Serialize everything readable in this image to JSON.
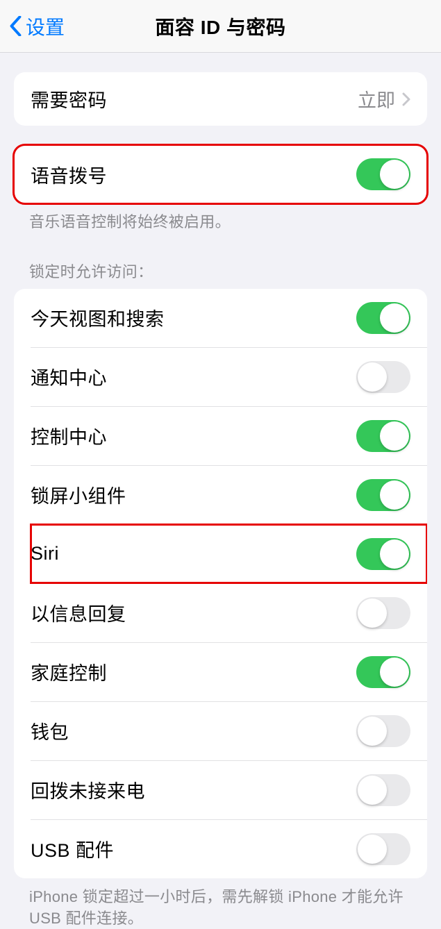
{
  "nav": {
    "back_label": "设置",
    "title": "面容 ID 与密码"
  },
  "require_passcode": {
    "label": "需要密码",
    "value": "立即"
  },
  "voice_dial": {
    "label": "语音拨号",
    "on": true,
    "footer": "音乐语音控制将始终被启用。"
  },
  "allow_access_header": "锁定时允许访问：",
  "allow_access": [
    {
      "label": "今天视图和搜索",
      "on": true
    },
    {
      "label": "通知中心",
      "on": false
    },
    {
      "label": "控制中心",
      "on": true
    },
    {
      "label": "锁屏小组件",
      "on": true
    },
    {
      "label": "Siri",
      "on": true
    },
    {
      "label": "以信息回复",
      "on": false
    },
    {
      "label": "家庭控制",
      "on": true
    },
    {
      "label": "钱包",
      "on": false
    },
    {
      "label": "回拨未接来电",
      "on": false
    },
    {
      "label": "USB 配件",
      "on": false
    }
  ],
  "usb_footer": "iPhone 锁定超过一小时后，需先解锁 iPhone 才能允许USB 配件连接。"
}
